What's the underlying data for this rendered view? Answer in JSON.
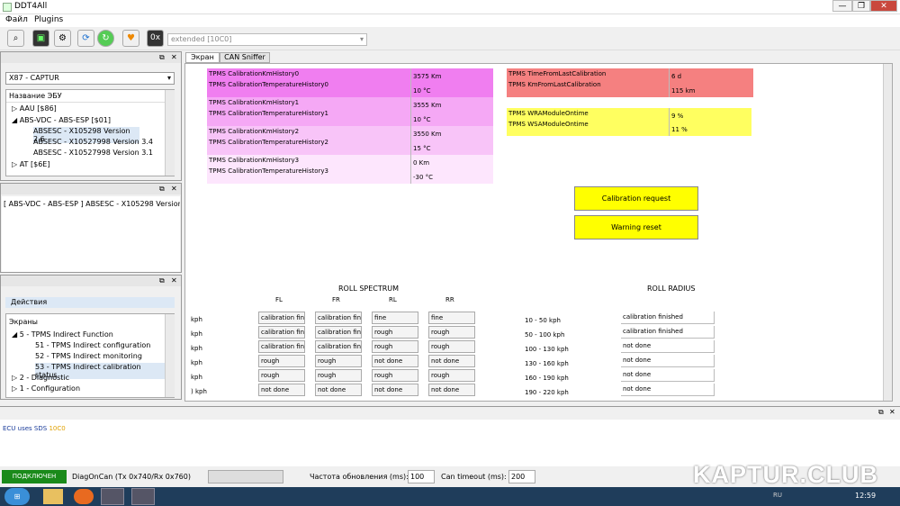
{
  "window": {
    "title": "DDT4All",
    "min": "—",
    "max": "❐",
    "close": "✕"
  },
  "menu": [
    "Файл",
    "Plugins"
  ],
  "toolbar": {
    "combo_value": "extended [10C0]",
    "hex_label": "0x"
  },
  "dock1": {
    "vehicle": "X87 - CAPTUR",
    "tree_header": "Название ЭБУ",
    "items": [
      "AAU [$86]",
      "ABS-VDC - ABS-ESP [$01]",
      "ABSESC - X105298 Version 2.6",
      "ABSESC - X10527998 Version 3.4",
      "ABSESC - X10527998 Version 3.1",
      "AT [$6E]"
    ]
  },
  "dock2": {
    "text": "[ ABS-VDC - ABS-ESP ] ABSESC - X105298 Version 2"
  },
  "dock3": {
    "section": "Действия",
    "tree_header": "Экраны",
    "items": [
      "5 - TPMS Indirect Function",
      "51 - TPMS Indirect configuration",
      "52 - TPMS Indirect monitoring",
      "53 - TPMS Indirect calibration status",
      "2 - Diagnostic",
      "1 - Configuration"
    ]
  },
  "tabs": [
    "Экран",
    "CAN Sniffer"
  ],
  "history": [
    {
      "label": "TPMS CalibrationKmHistory0",
      "value": "3575 Km",
      "color": "#f07ef0"
    },
    {
      "label": "TPMS CalibrationTemperatureHistory0",
      "value": "10 °C",
      "color": "#f07ef0"
    },
    {
      "label": "TPMS CalibrationKmHistory1",
      "value": "3555 Km",
      "color": "#f5a8f5"
    },
    {
      "label": "TPMS CalibrationTemperatureHistory1",
      "value": "10 °C",
      "color": "#f5a8f5"
    },
    {
      "label": "TPMS CalibrationKmHistory2",
      "value": "3550 Km",
      "color": "#f8c4f8"
    },
    {
      "label": "TPMS CalibrationTemperatureHistory2",
      "value": "15 °C",
      "color": "#f8c4f8"
    },
    {
      "label": "TPMS CalibrationKmHistory3",
      "value": "0 Km",
      "color": "#fde6fd"
    },
    {
      "label": "TPMS CalibrationTemperatureHistory3",
      "value": "-30 °C",
      "color": "#fde6fd"
    }
  ],
  "calib": [
    {
      "label": "TPMS TimeFromLastCalibration",
      "value": "6 d"
    },
    {
      "label": "TPMS KmFromLastCalibration",
      "value": "115 km"
    }
  ],
  "ontime": [
    {
      "label": "TPMS WRAModuleOntime",
      "value": "9 %"
    },
    {
      "label": "TPMS WSAModuleOntime",
      "value": "11 %"
    }
  ],
  "buttons": {
    "calibration": "Calibration request",
    "warning": "Warning reset"
  },
  "spectrum": {
    "title": "ROLL SPECTRUM",
    "wheels": [
      "FL",
      "FR",
      "RL",
      "RR"
    ],
    "speed_rows": [
      "kph",
      "kph",
      "kph",
      "kph",
      "kph",
      ") kph"
    ],
    "cols": [
      [
        "calibration finis",
        "calibration finis",
        "calibration finis",
        "rough",
        "rough",
        "not done"
      ],
      [
        "calibration finis",
        "calibration finis",
        "calibration finis",
        "rough",
        "rough",
        "not done"
      ],
      [
        "fine",
        "rough",
        "rough",
        "not done",
        "rough",
        "not done"
      ],
      [
        "fine",
        "rough",
        "rough",
        "not done",
        "rough",
        "not done"
      ]
    ]
  },
  "radius": {
    "title": "ROLL RADIUS",
    "rows": [
      {
        "speed": "10 - 50 kph",
        "value": "calibration finished"
      },
      {
        "speed": "50 - 100 kph",
        "value": "calibration finished"
      },
      {
        "speed": "100 - 130 kph",
        "value": "not done"
      },
      {
        "speed": "130 - 160 kph",
        "value": "not done"
      },
      {
        "speed": "160 - 190 kph",
        "value": "not done"
      },
      {
        "speed": "190 - 220 kph",
        "value": "not done"
      }
    ]
  },
  "log": {
    "text": "ECU uses SDS",
    "code": "10C0"
  },
  "status": {
    "connected": "ПОДКЛЮЧЕН",
    "protocol": "DiagOnCan (Tx 0x740/Rx 0x760)",
    "refresh_label": "Частота обновления (ms):",
    "refresh_value": "100",
    "timeout_label": "Can timeout (ms):",
    "timeout_value": "200"
  },
  "taskbar": {
    "lang": "RU",
    "time": "12:59"
  },
  "watermark": "KAPTUR.CLUB",
  "colors": {
    "pink_calib": "#f58080",
    "yellow": "#ffff60",
    "button": "#ffff00",
    "connected": "#1a8a1a"
  }
}
